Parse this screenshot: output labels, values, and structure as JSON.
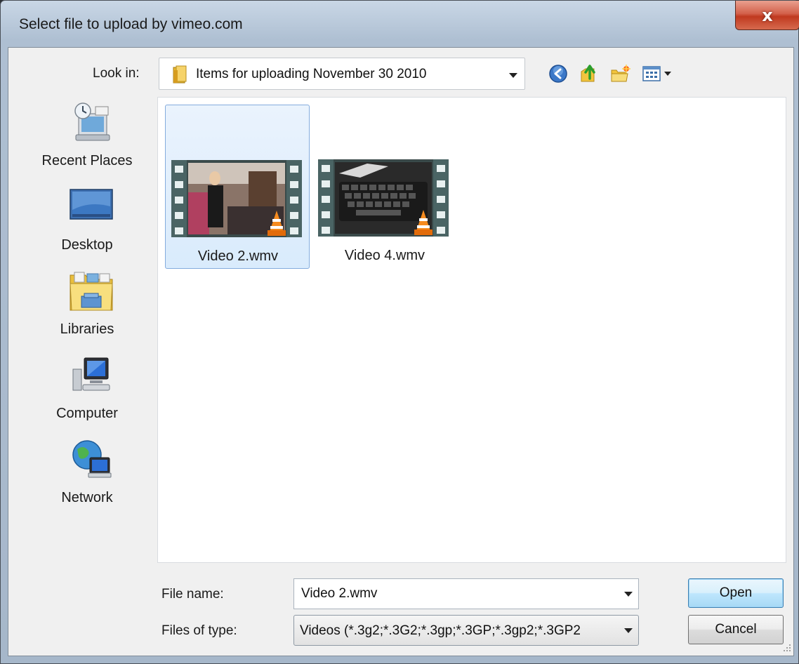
{
  "window": {
    "title": "Select file to upload by vimeo.com",
    "close_label": "x"
  },
  "lookin": {
    "label": "Look in:",
    "value": "Items for uploading November 30 2010"
  },
  "toolbar": {
    "icons": [
      "back-icon",
      "up-folder-icon",
      "new-folder-icon",
      "views-menu-icon"
    ]
  },
  "places": [
    {
      "label": "Recent Places",
      "icon": "recent-places-icon"
    },
    {
      "label": "Desktop",
      "icon": "desktop-icon"
    },
    {
      "label": "Libraries",
      "icon": "libraries-icon"
    },
    {
      "label": "Computer",
      "icon": "computer-icon"
    },
    {
      "label": "Network",
      "icon": "network-icon"
    }
  ],
  "files": [
    {
      "name": "Video 2.wmv",
      "selected": true
    },
    {
      "name": "Video 4.wmv",
      "selected": false
    }
  ],
  "filename": {
    "label": "File name:",
    "value": "Video 2.wmv"
  },
  "filetype": {
    "label": "Files of type:",
    "value": "Videos (*.3g2;*.3G2;*.3gp;*.3GP;*.3gp2;*.3GP2"
  },
  "buttons": {
    "open": "Open",
    "cancel": "Cancel"
  },
  "colors": {
    "selection": "#d9ebfc",
    "selection_border": "#84acdd",
    "close_red": "#c0391f"
  }
}
